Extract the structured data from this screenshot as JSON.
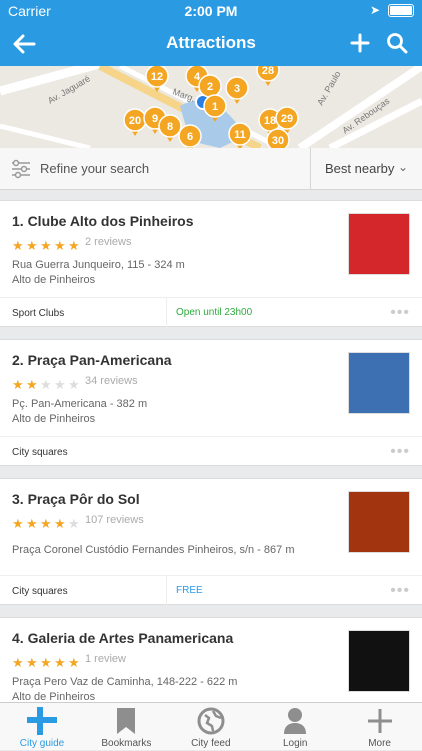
{
  "status_bar": {
    "carrier": "Carrier",
    "time": "2:00 PM"
  },
  "nav": {
    "title": "Attractions",
    "back_icon": "arrow-left-icon",
    "add_icon": "plus-icon",
    "search_icon": "search-icon"
  },
  "map": {
    "streets": [
      "Av. Jaguaré",
      "Av. Paulo",
      "Av. Rebouças",
      "Marg."
    ],
    "clusters": [
      "12",
      "4",
      "2",
      "3",
      "28",
      "1",
      "20",
      "9",
      "8",
      "18",
      "29",
      "11",
      "30",
      "6"
    ]
  },
  "filter": {
    "refine_label": "Refine your search",
    "sort_label": "Best nearby"
  },
  "places": [
    {
      "name": "1. Clube Alto dos Pinheiros",
      "rating": 5,
      "reviews": "2 reviews",
      "address": "Rua Guerra Junqueiro, 115 - 324 m",
      "area": "Alto de Pinheiros",
      "category": "Sport Clubs",
      "extra": "Open until 23h00",
      "extra_color": "#2eaa3f",
      "thumb_color": "#d3272b"
    },
    {
      "name": "2. Praça Pan-Americana",
      "rating": 2,
      "reviews": "34 reviews",
      "address": "Pç. Pan-Americana - 382 m",
      "area": "Alto de Pinheiros",
      "category": "City squares",
      "extra": "",
      "extra_color": "#2a9be3",
      "thumb_color": "#3d6fb3"
    },
    {
      "name": "3. Praça Pôr do Sol",
      "rating": 4,
      "reviews": "107 reviews",
      "address": "Praça Coronel Custódio Fernandes Pinheiros, s/n - 867 m",
      "area": "",
      "category": "City squares",
      "extra": "FREE",
      "extra_color": "#2a9be3",
      "thumb_color": "#a23410"
    },
    {
      "name": "4. Galeria de Artes Panamericana",
      "rating": 5,
      "reviews": "1 review",
      "address": "Praça Pero Vaz de Caminha, 148-222 - 622 m",
      "area": "Alto de Pinheiros",
      "category": "",
      "extra": "",
      "extra_color": "#2a9be3",
      "thumb_color": "#111111"
    }
  ],
  "tabs": [
    {
      "label": "City guide",
      "icon": "city-guide-icon",
      "active": true
    },
    {
      "label": "Bookmarks",
      "icon": "bookmark-icon",
      "active": false
    },
    {
      "label": "City feed",
      "icon": "city-feed-icon",
      "active": false
    },
    {
      "label": "Login",
      "icon": "user-icon",
      "active": false
    },
    {
      "label": "More",
      "icon": "plus-icon",
      "active": false
    }
  ],
  "colors": {
    "accent": "#2a9be3",
    "star": "#f4a623",
    "star_empty": "#dddddd",
    "pin": "#f4a623"
  }
}
